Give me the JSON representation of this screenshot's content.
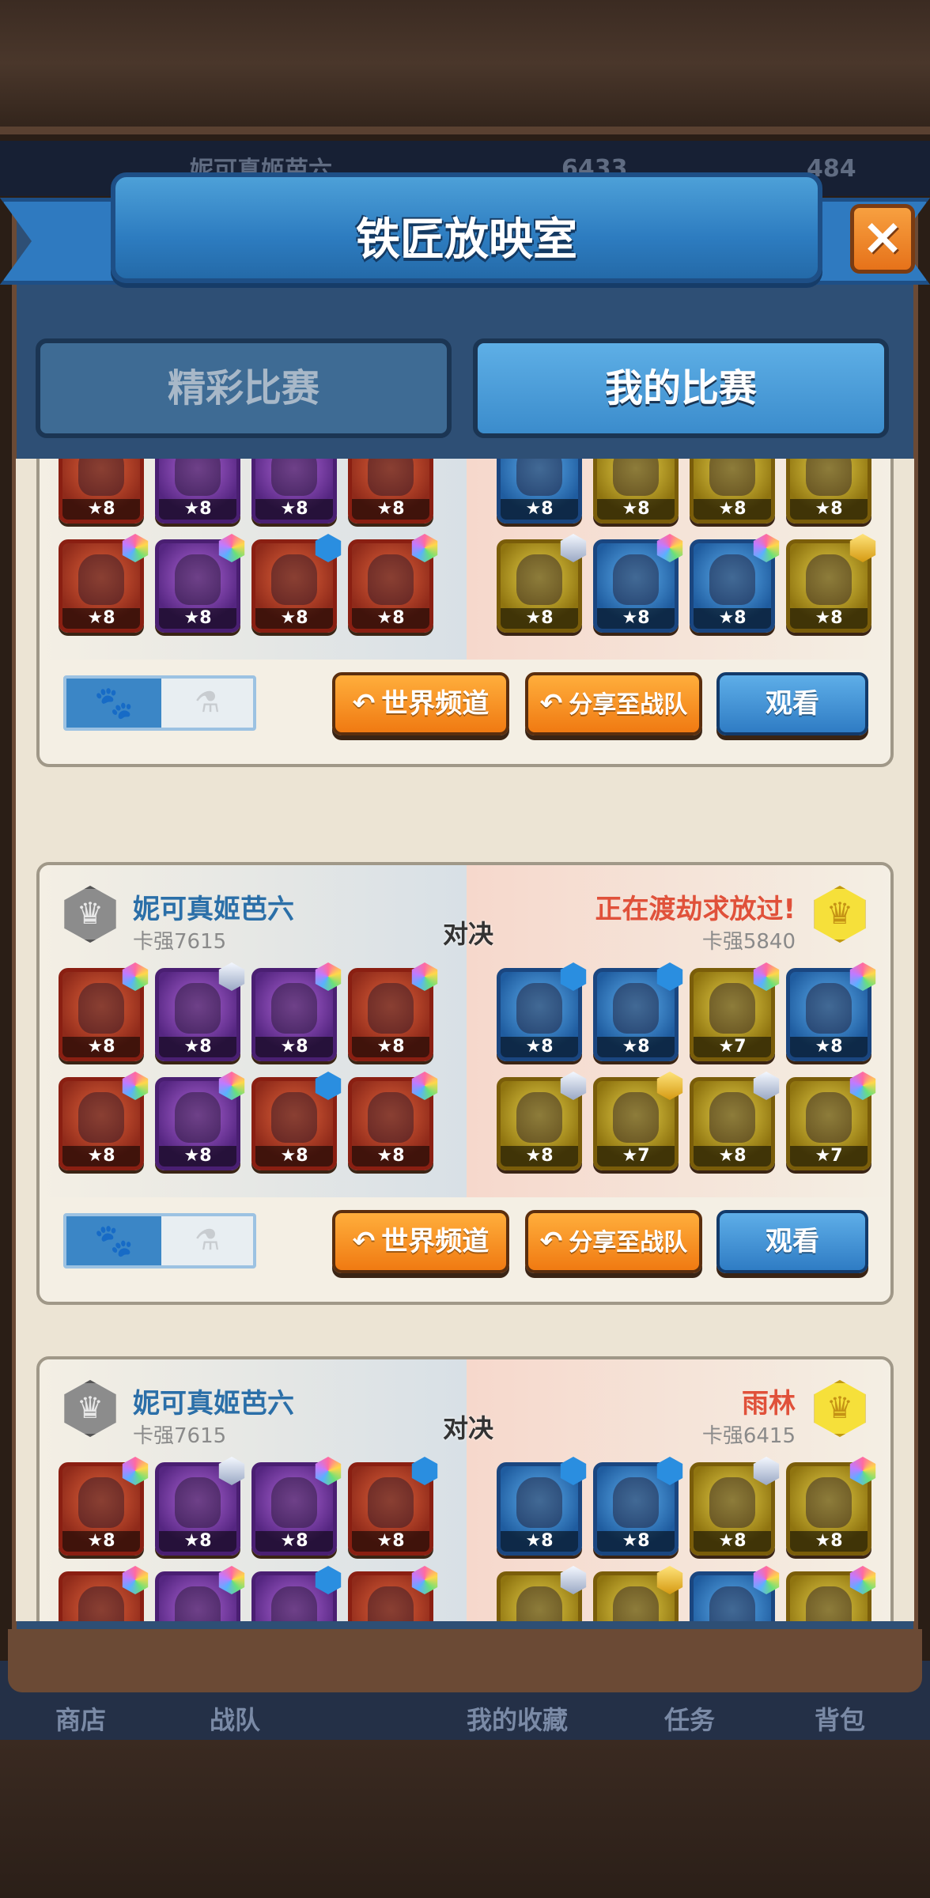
{
  "background": {
    "player_name": "妮可真姬芭六",
    "gold": "6433",
    "gems": "484",
    "nav_items": [
      "商店",
      "战队",
      "我的收藏",
      "任务",
      "背包"
    ]
  },
  "dialog": {
    "title": "铁匠放映室",
    "close_label": "×",
    "tabs": [
      {
        "label": "精彩比赛",
        "active": false
      },
      {
        "label": "我的比赛",
        "active": true
      }
    ]
  },
  "colors": {
    "accent_blue": "#2f7cc4",
    "orange": "#f07a12",
    "player_blue": "#2b6fa8",
    "opponent_red": "#e0513a"
  },
  "matches": [
    {
      "player": {
        "name": "",
        "power": "",
        "rank_icon": "silver-crown-icon"
      },
      "opponent": {
        "name": "",
        "power": "",
        "rank_icon": "gold-crown-icon"
      },
      "vs_label": "",
      "left_team": [
        {
          "star": "★8",
          "gem": "rainbow",
          "tone": "red"
        },
        {
          "star": "★8",
          "gem": "silver",
          "tone": "purple"
        },
        {
          "star": "★8",
          "gem": "rainbow",
          "tone": "purple"
        },
        {
          "star": "★8",
          "gem": "bluestar",
          "tone": "red"
        },
        {
          "star": "★8",
          "gem": "rainbow",
          "tone": "red"
        },
        {
          "star": "★8",
          "gem": "rainbow",
          "tone": "purple"
        },
        {
          "star": "★8",
          "gem": "bluestar",
          "tone": "red"
        },
        {
          "star": "★8",
          "gem": "rainbow",
          "tone": "red"
        }
      ],
      "right_team": [
        {
          "star": "★8",
          "gem": "bluestar",
          "tone": "blue"
        },
        {
          "star": "★8",
          "gem": "rainbow",
          "tone": "gold"
        },
        {
          "star": "★8",
          "gem": "gold",
          "tone": "gold"
        },
        {
          "star": "★8",
          "gem": "rainbow",
          "tone": "gold"
        },
        {
          "star": "★8",
          "gem": "silver",
          "tone": "gold"
        },
        {
          "star": "★8",
          "gem": "rainbow",
          "tone": "blue"
        },
        {
          "star": "★8",
          "gem": "rainbow",
          "tone": "blue"
        },
        {
          "star": "★8",
          "gem": "gold",
          "tone": "gold"
        }
      ],
      "toggle": {
        "on_icon": "🐾",
        "off_icon": "⚗"
      },
      "buttons": {
        "world": "世界频道",
        "share": "分享至战队",
        "watch": "观看"
      }
    },
    {
      "player": {
        "name": "妮可真姬芭六",
        "power": "卡强7615",
        "rank_icon": "silver-crown-icon"
      },
      "opponent": {
        "name": "正在渡劫求放过!",
        "power": "卡强5840",
        "rank_icon": "gold-crown-icon"
      },
      "vs_label": "对决",
      "left_team": [
        {
          "star": "★8",
          "gem": "rainbow",
          "tone": "red"
        },
        {
          "star": "★8",
          "gem": "silver",
          "tone": "purple"
        },
        {
          "star": "★8",
          "gem": "rainbow",
          "tone": "purple"
        },
        {
          "star": "★8",
          "gem": "rainbow",
          "tone": "red"
        },
        {
          "star": "★8",
          "gem": "rainbow",
          "tone": "red"
        },
        {
          "star": "★8",
          "gem": "rainbow",
          "tone": "purple"
        },
        {
          "star": "★8",
          "gem": "bluestar",
          "tone": "red"
        },
        {
          "star": "★8",
          "gem": "rainbow",
          "tone": "red"
        }
      ],
      "right_team": [
        {
          "star": "★8",
          "gem": "bluestar",
          "tone": "blue"
        },
        {
          "star": "★8",
          "gem": "bluestar",
          "tone": "blue"
        },
        {
          "star": "★7",
          "gem": "rainbow",
          "tone": "gold"
        },
        {
          "star": "★8",
          "gem": "rainbow",
          "tone": "blue"
        },
        {
          "star": "★8",
          "gem": "silver",
          "tone": "gold"
        },
        {
          "star": "★7",
          "gem": "gold",
          "tone": "gold"
        },
        {
          "star": "★8",
          "gem": "silver",
          "tone": "gold"
        },
        {
          "star": "★7",
          "gem": "rainbow",
          "tone": "gold"
        }
      ],
      "toggle": {
        "on_icon": "🐾",
        "off_icon": "⚗"
      },
      "buttons": {
        "world": "世界频道",
        "share": "分享至战队",
        "watch": "观看"
      }
    },
    {
      "player": {
        "name": "妮可真姬芭六",
        "power": "卡强7615",
        "rank_icon": "silver-crown-icon"
      },
      "opponent": {
        "name": "雨林",
        "power": "卡强6415",
        "rank_icon": "gold-crown-icon"
      },
      "vs_label": "对决",
      "left_team": [
        {
          "star": "★8",
          "gem": "rainbow",
          "tone": "red"
        },
        {
          "star": "★8",
          "gem": "silver",
          "tone": "purple"
        },
        {
          "star": "★8",
          "gem": "rainbow",
          "tone": "purple"
        },
        {
          "star": "★8",
          "gem": "bluestar",
          "tone": "red"
        },
        {
          "star": "",
          "gem": "rainbow",
          "tone": "red"
        },
        {
          "star": "",
          "gem": "rainbow",
          "tone": "purple"
        },
        {
          "star": "",
          "gem": "bluestar",
          "tone": "purple"
        },
        {
          "star": "",
          "gem": "rainbow",
          "tone": "red"
        }
      ],
      "right_team": [
        {
          "star": "★8",
          "gem": "bluestar",
          "tone": "blue"
        },
        {
          "star": "★8",
          "gem": "bluestar",
          "tone": "blue"
        },
        {
          "star": "★8",
          "gem": "silver",
          "tone": "gold"
        },
        {
          "star": "★8",
          "gem": "rainbow",
          "tone": "gold"
        },
        {
          "star": "",
          "gem": "silver",
          "tone": "gold"
        },
        {
          "star": "",
          "gem": "gold",
          "tone": "gold"
        },
        {
          "star": "",
          "gem": "rainbow",
          "tone": "blue"
        },
        {
          "star": "",
          "gem": "rainbow",
          "tone": "gold"
        }
      ],
      "toggle": {
        "on_icon": "",
        "off_icon": ""
      },
      "buttons": {
        "world": "",
        "share": "",
        "watch": ""
      }
    }
  ]
}
